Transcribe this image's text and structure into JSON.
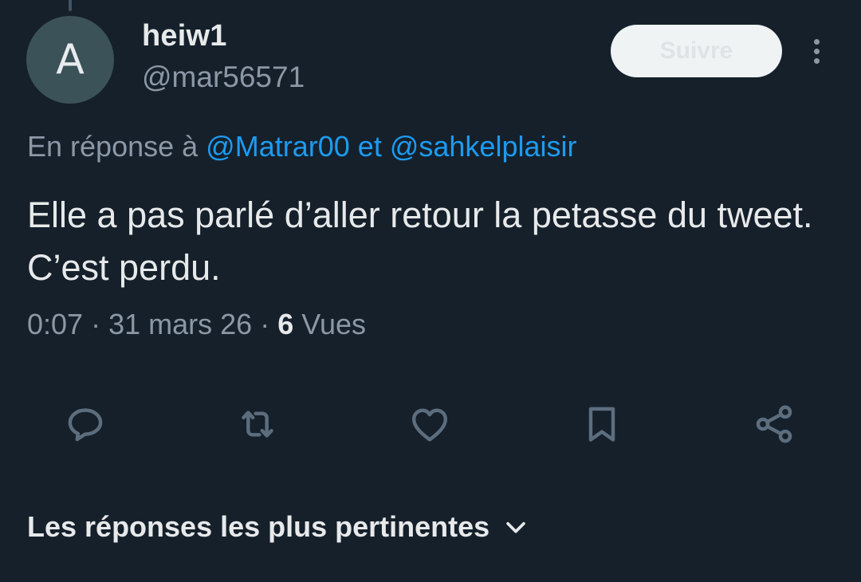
{
  "author": {
    "avatar_letter": "A",
    "display_name": "heiw1",
    "handle": "@mar56571"
  },
  "follow_button": {
    "label": "Suivre"
  },
  "reply_context": {
    "prefix": "En réponse à",
    "mention_1": "@Matrar00",
    "conjunction": "et",
    "mention_2": "@sahkelplaisir"
  },
  "tweet": {
    "text": "Elle a pas parlé d’aller retour la petasse du tweet. C’est perdu."
  },
  "meta": {
    "time": "0:07",
    "separator": "·",
    "date": "31 mars 26",
    "views_count": "6",
    "views_label": "Vues"
  },
  "actions": {
    "icons": [
      "reply-icon",
      "retweet-icon",
      "like-icon",
      "bookmark-icon",
      "share-icon"
    ],
    "icon_color": "#5c6e7e"
  },
  "replies_sort": {
    "label": "Les réponses les plus pertinentes",
    "icon": "chevron-down-icon"
  },
  "colors": {
    "background": "#15202b",
    "text_primary": "#e7e9ea",
    "text_secondary": "#8b98a5",
    "link": "#1d9bf0",
    "avatar_bg": "#3b5258",
    "follow_button_bg": "#eff3f4"
  }
}
